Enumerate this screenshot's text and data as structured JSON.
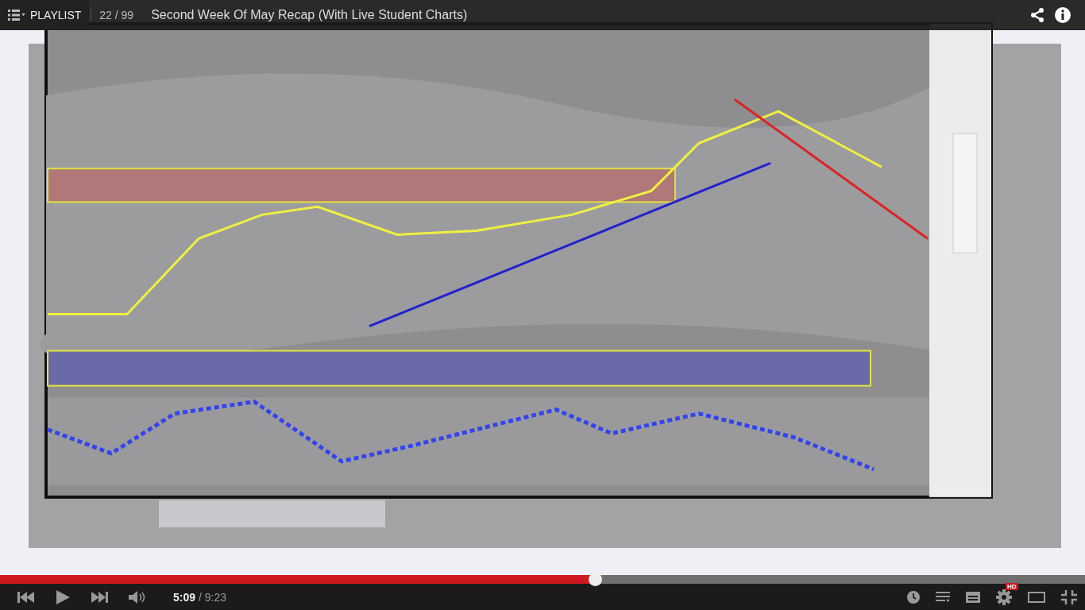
{
  "top_bar": {
    "playlist_label": "PLAYLIST",
    "position": "22 / 99",
    "title": "Second Week Of May Recap (With Live Student Charts)"
  },
  "progress": {
    "level": 0.548
  },
  "controls": {
    "current_time": "5:09",
    "duration": "/ 9:23",
    "hd_badge": "HD"
  }
}
